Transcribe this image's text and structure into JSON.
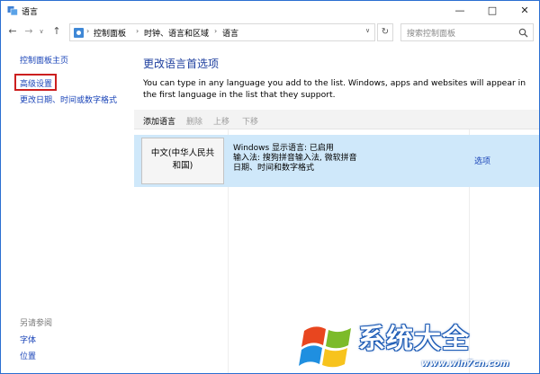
{
  "window": {
    "title": "语言"
  },
  "address": {
    "crumbs": [
      "控制面板",
      "时钟、语言和区域",
      "语言"
    ],
    "search_placeholder": "搜索控制面板"
  },
  "left_pane": {
    "home": "控制面板主页",
    "advanced": "高级设置",
    "datetime": "更改日期、时间或数字格式",
    "see_also_title": "另请参阅",
    "fonts": "字体",
    "location": "位置"
  },
  "main": {
    "heading": "更改语言首选项",
    "description": "You can type in any language you add to the list. Windows, apps and websites will appear in the first language in the list that they support.",
    "toolbar": {
      "add": "添加语言",
      "remove": "删除",
      "up": "上移",
      "down": "下移"
    },
    "languages": [
      {
        "name_line1": "中文(中华人民共",
        "name_line2": "和国)",
        "display": "Windows 显示语言: 已启用",
        "input": "输入法: 搜狗拼音输入法, 微软拼音",
        "format": "日期、时间和数字格式",
        "options": "选项"
      }
    ]
  },
  "watermark": {
    "text": "系统大全",
    "url": "www.win7cn.com"
  },
  "colors": {
    "accent": "#1e3f9f",
    "link": "#1a44b8",
    "selection": "#cfe8fa",
    "highlight": "#cc1f1f"
  }
}
